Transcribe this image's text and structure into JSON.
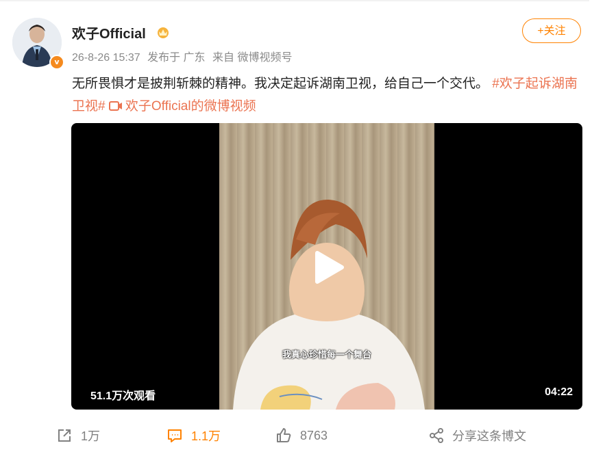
{
  "post": {
    "username": "欢子Official",
    "date": "26-8-26 15:37",
    "location": "发布于 广东",
    "source": "来自 微博视频号",
    "follow_label": "+关注",
    "text": "无所畏惧才是披荆斩棘的精神。我决定起诉湖南卫视，给自己一个交代。",
    "hashtag": "#欢子起诉湖南卫视#",
    "video_link": "欢子Official的微博视频"
  },
  "video": {
    "subtitle": "我真心珍惜每一个舞台",
    "view_count": "51.1万次观看",
    "duration": "04:22"
  },
  "actions": {
    "share_count": "1万",
    "comment_count": "1.1万",
    "like_count": "8763",
    "share_post_label": "分享这条博文"
  },
  "colors": {
    "accent": "#ff8200",
    "link": "#eb7350",
    "meta": "#8a8a8a"
  },
  "icons": [
    "verified-badge-icon",
    "vip-crown-icon",
    "video-icon",
    "play-icon",
    "repost-icon",
    "comment-icon",
    "like-icon",
    "share-icon"
  ]
}
